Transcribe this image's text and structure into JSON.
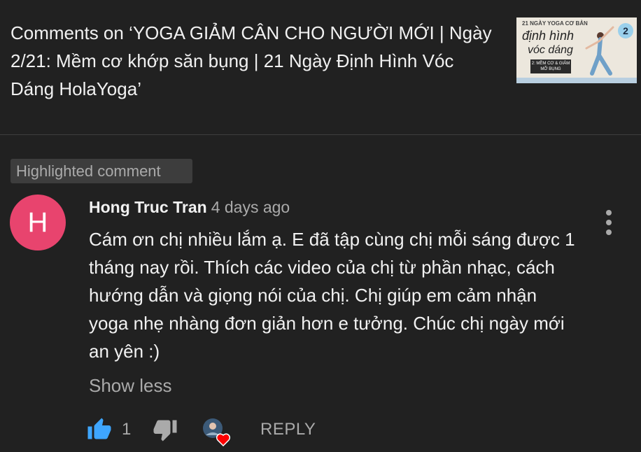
{
  "header": {
    "title": "Comments on ‘YOGA GIẢM CÂN CHO NGƯỜI MỚI | Ngày 2/21: Mềm cơ khớp săn bụng | 21 Ngày Định Hình Vóc Dáng HolaYoga’",
    "thumbnail": {
      "series_text": "21 NGÀY YOGA CƠ BẢN",
      "line1": "định hình",
      "line2": "vóc dáng",
      "box_text": "2: MỀM CƠ & GIẢM MỠ BỤNG",
      "number": "2"
    }
  },
  "comment": {
    "highlight_label": "Highlighted comment",
    "avatar_letter": "H",
    "avatar_color": "#e8446e",
    "author": "Hong Truc Tran",
    "timestamp": "4 days ago",
    "text": "Cám ơn chị nhiều lắm ạ. E đã tập cùng chị mỗi sáng được 1 tháng nay rồi. Thích các video của chị từ phần nhạc, cách hướng dẫn và giọng nói của chị. Chị giúp em cảm nhận yoga nhẹ nhàng đơn giản hơn e tưởng. Chúc chị ngày mới an yên :)",
    "show_less_label": "Show less",
    "like_count": "1",
    "reply_label": "REPLY"
  },
  "icons": {
    "like": "thumbs-up-icon",
    "dislike": "thumbs-down-icon",
    "menu": "more-vertical-icon",
    "creator_heart": "creator-heart-icon"
  },
  "colors": {
    "background": "#212121",
    "like_active": "#3ea6ff",
    "heart": "#ff0000"
  }
}
